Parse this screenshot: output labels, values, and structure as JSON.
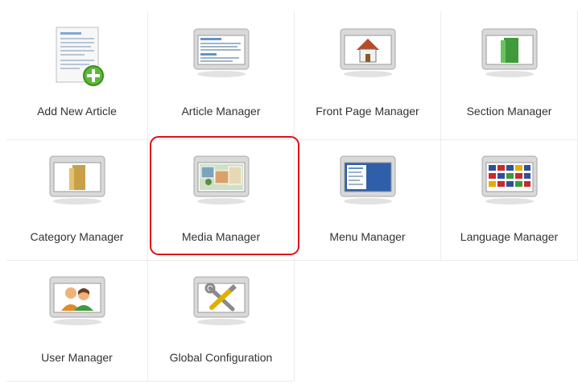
{
  "panel": {
    "items": [
      {
        "label": "Add New Article",
        "icon": "add-article-icon"
      },
      {
        "label": "Article Manager",
        "icon": "article-manager-icon"
      },
      {
        "label": "Front Page Manager",
        "icon": "front-page-icon"
      },
      {
        "label": "Section Manager",
        "icon": "section-manager-icon"
      },
      {
        "label": "Category Manager",
        "icon": "category-manager-icon"
      },
      {
        "label": "Media Manager",
        "icon": "media-manager-icon"
      },
      {
        "label": "Menu Manager",
        "icon": "menu-manager-icon"
      },
      {
        "label": "Language Manager",
        "icon": "language-manager-icon"
      },
      {
        "label": "User Manager",
        "icon": "user-manager-icon"
      },
      {
        "label": "Global Configuration",
        "icon": "global-configuration-icon"
      }
    ],
    "highlighted_item": "Media Manager",
    "highlight_color": "#e0101a"
  }
}
